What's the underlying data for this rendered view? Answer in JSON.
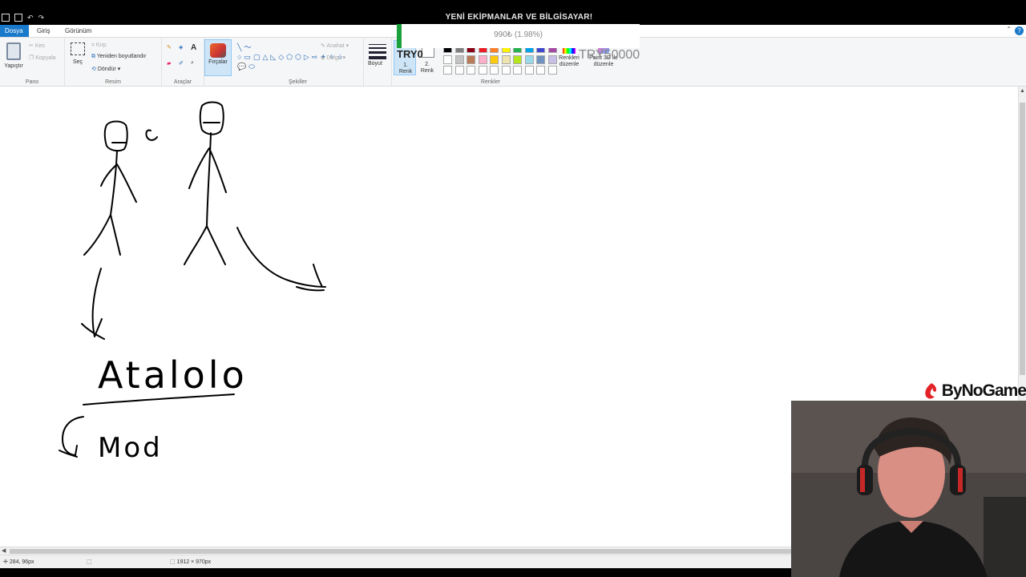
{
  "window": {
    "title": "YENİ EKİPMANLAR VE BİLGİSAYAR!"
  },
  "tabs": [
    "Dosya",
    "Giriş",
    "Görünüm"
  ],
  "ribbon": {
    "pano": {
      "label": "Pano",
      "paste": "Yapıştır",
      "cut": "Kes",
      "copy": "Kopyala"
    },
    "resim": {
      "label": "Resim",
      "select": "Seç",
      "crop": "Kırp",
      "resize": "Yeniden boyutlandır",
      "rotate": "Döndür"
    },
    "araclar": {
      "label": "Araçlar"
    },
    "fircalar": {
      "label": "Fırçalar"
    },
    "sekiller": {
      "label": "Şekiller",
      "outline": "Anahat",
      "fill": "Dolgu"
    },
    "boyut": {
      "label": "Boyut"
    },
    "renk1": {
      "label": "1. Renk"
    },
    "renk2": {
      "label": "2. Renk"
    },
    "renkler": {
      "label": "Renkler",
      "edit": "Renkleri düzenle",
      "paint3d": "Paint 3D ile düzenle"
    }
  },
  "palette": {
    "row1": [
      "#000000",
      "#7f7f7f",
      "#880015",
      "#ed1c24",
      "#ff7f27",
      "#fff200",
      "#22b14c",
      "#00a2e8",
      "#3f48cc",
      "#a349a4"
    ],
    "row2": [
      "#ffffff",
      "#c3c3c3",
      "#b97a57",
      "#ffaec9",
      "#ffc90e",
      "#efe4b0",
      "#b5e61d",
      "#99d9ea",
      "#7092be",
      "#c8bfe7"
    ],
    "row3": [
      "#ffffff",
      "#ffffff",
      "#ffffff",
      "#ffffff",
      "#ffffff",
      "#ffffff",
      "#ffffff",
      "#ffffff",
      "#ffffff",
      "#ffffff"
    ]
  },
  "donation": {
    "goal_text": "990₺ (1.98%)",
    "progress_fraction": 0.0198,
    "left_label": "TRY0",
    "right_label": "TRY50000"
  },
  "canvas": {
    "word": "Atalolo",
    "mod": "Mod"
  },
  "status": {
    "cursor": "284, 96px",
    "size": "1912 × 970px"
  },
  "brand": {
    "name": "ByNoGame"
  }
}
